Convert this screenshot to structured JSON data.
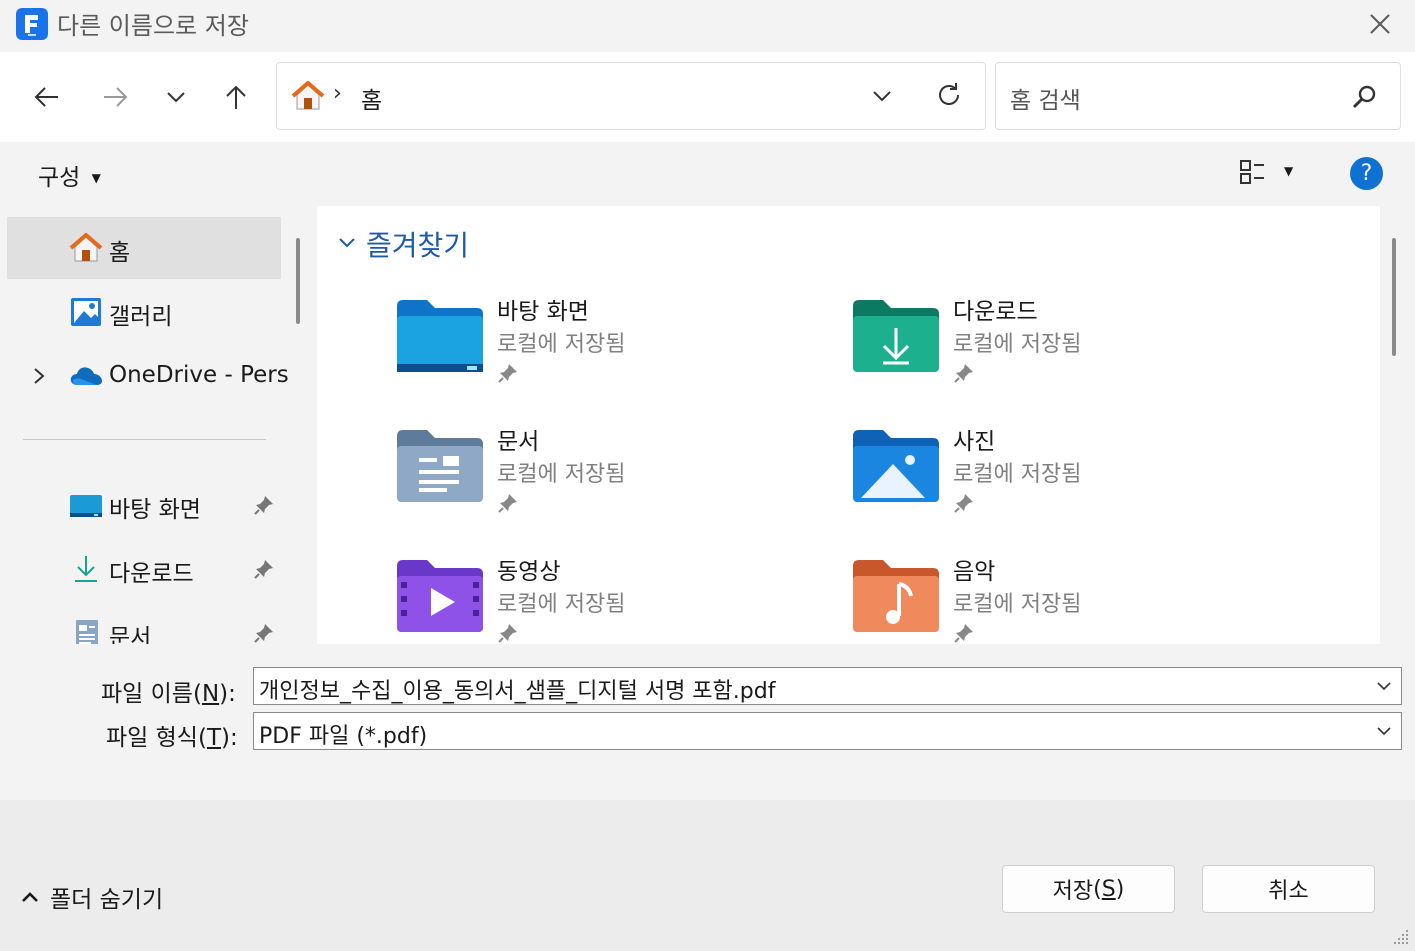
{
  "window": {
    "title": "다른 이름으로 저장"
  },
  "address": {
    "crumb_sep": "›",
    "location": "홈"
  },
  "search": {
    "placeholder": "홈 검색"
  },
  "command_bar": {
    "organize": "구성"
  },
  "nav_pane": {
    "items": [
      {
        "label": "홈",
        "selected": true
      },
      {
        "label": "갤러리"
      },
      {
        "label": "OneDrive - Pers"
      },
      {
        "label": "바탕 화면"
      },
      {
        "label": "다운로드"
      },
      {
        "label": "문서"
      }
    ]
  },
  "content": {
    "group_title": "즐겨찾기",
    "tiles": [
      {
        "name": "바탕 화면",
        "sub": "로컬에 저장됨"
      },
      {
        "name": "다운로드",
        "sub": "로컬에 저장됨"
      },
      {
        "name": "문서",
        "sub": "로컬에 저장됨"
      },
      {
        "name": "사진",
        "sub": "로컬에 저장됨"
      },
      {
        "name": "동영상",
        "sub": "로컬에 저장됨"
      },
      {
        "name": "음악",
        "sub": "로컬에 저장됨"
      }
    ]
  },
  "form": {
    "filename_label": "파일 이름",
    "filename_key": "N",
    "filename_value": "개인정보_수집_이용_동의서_샘플_디지털 서명 포함.pdf",
    "filetype_label": "파일 형식",
    "filetype_key": "T",
    "filetype_value": "PDF 파일 (*.pdf)"
  },
  "footer": {
    "hide_folders": "폴더 숨기기",
    "save": "저장",
    "save_key": "S",
    "cancel": "취소"
  },
  "colors": {
    "accent": "#0067c0",
    "group_title": "#1e5aa8",
    "selected": "#e0e0e0"
  }
}
